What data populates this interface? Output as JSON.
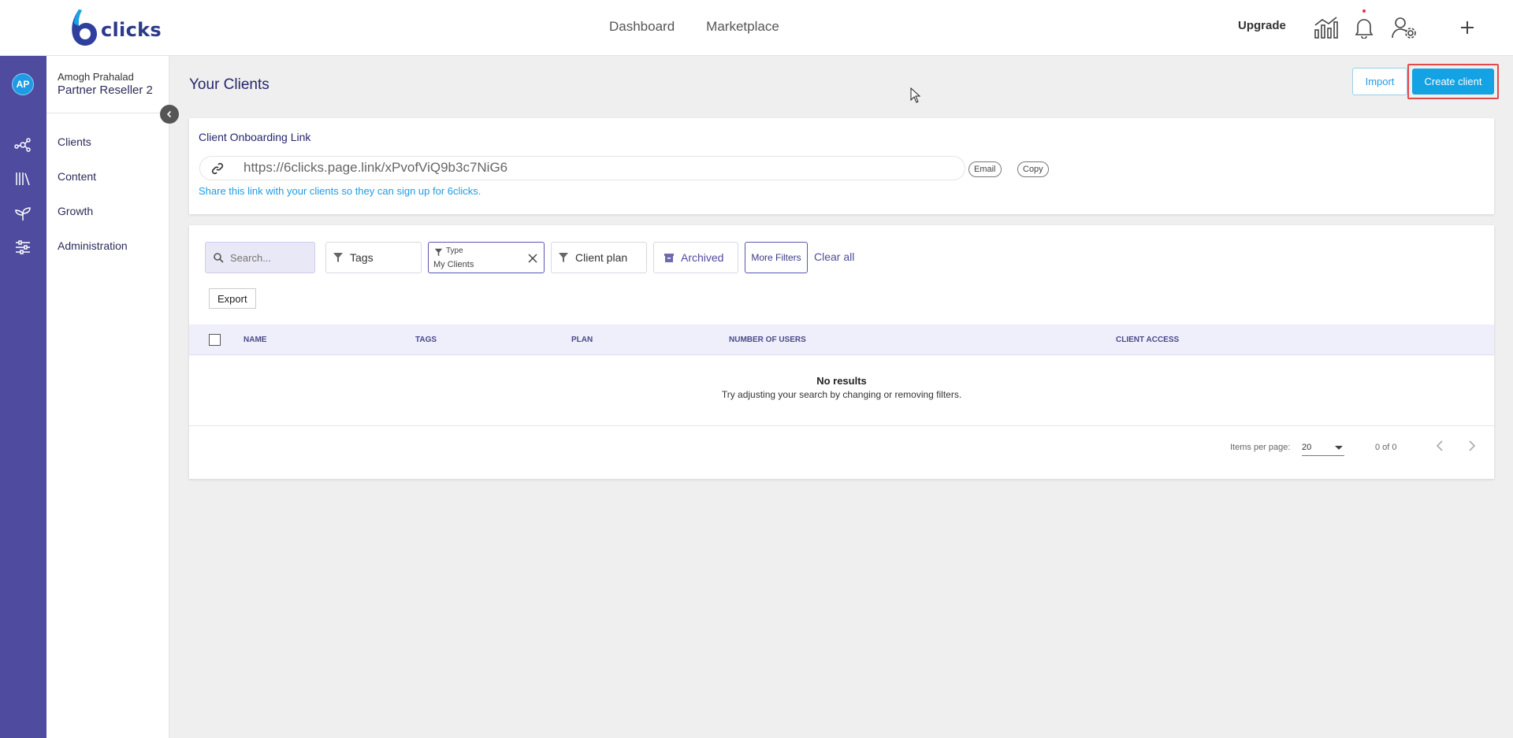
{
  "brand": {
    "logo_text": "clicks"
  },
  "topnav": {
    "dashboard": "Dashboard",
    "marketplace": "Marketplace",
    "upgrade": "Upgrade"
  },
  "user": {
    "initials": "AP",
    "name": "Amogh Prahalad",
    "org": "Partner Reseller 2"
  },
  "sidebar": {
    "items": [
      {
        "label": "Clients",
        "icon": "network-icon"
      },
      {
        "label": "Content",
        "icon": "library-icon"
      },
      {
        "label": "Growth",
        "icon": "sprout-icon"
      },
      {
        "label": "Administration",
        "icon": "sliders-icon"
      }
    ]
  },
  "page": {
    "title": "Your Clients",
    "import_label": "Import",
    "create_label": "Create client"
  },
  "onboarding": {
    "title": "Client Onboarding Link",
    "url": "https://6clicks.page.link/xPvofViQ9b3c7NiG6",
    "email_label": "Email",
    "copy_label": "Copy",
    "hint": "Share this link with your clients so they can sign up for 6clicks."
  },
  "filters": {
    "search_placeholder": "Search...",
    "tags": "Tags",
    "type_label": "Type",
    "type_value": "My Clients",
    "client_plan": "Client plan",
    "archived": "Archived",
    "more_filters": "More Filters",
    "clear_all": "Clear all",
    "export": "Export"
  },
  "table": {
    "columns": [
      "NAME",
      "TAGS",
      "PLAN",
      "NUMBER OF USERS",
      "CLIENT ACCESS"
    ],
    "empty_title": "No results",
    "empty_sub": "Try adjusting your search by changing or removing filters."
  },
  "pagination": {
    "items_per_page_label": "Items per page:",
    "items_per_page": "20",
    "range": "0 of 0"
  },
  "colors": {
    "rail": "#4f4b9e",
    "accent": "#13a2e4",
    "title": "#25266b",
    "highlight": "#e24a4a"
  }
}
